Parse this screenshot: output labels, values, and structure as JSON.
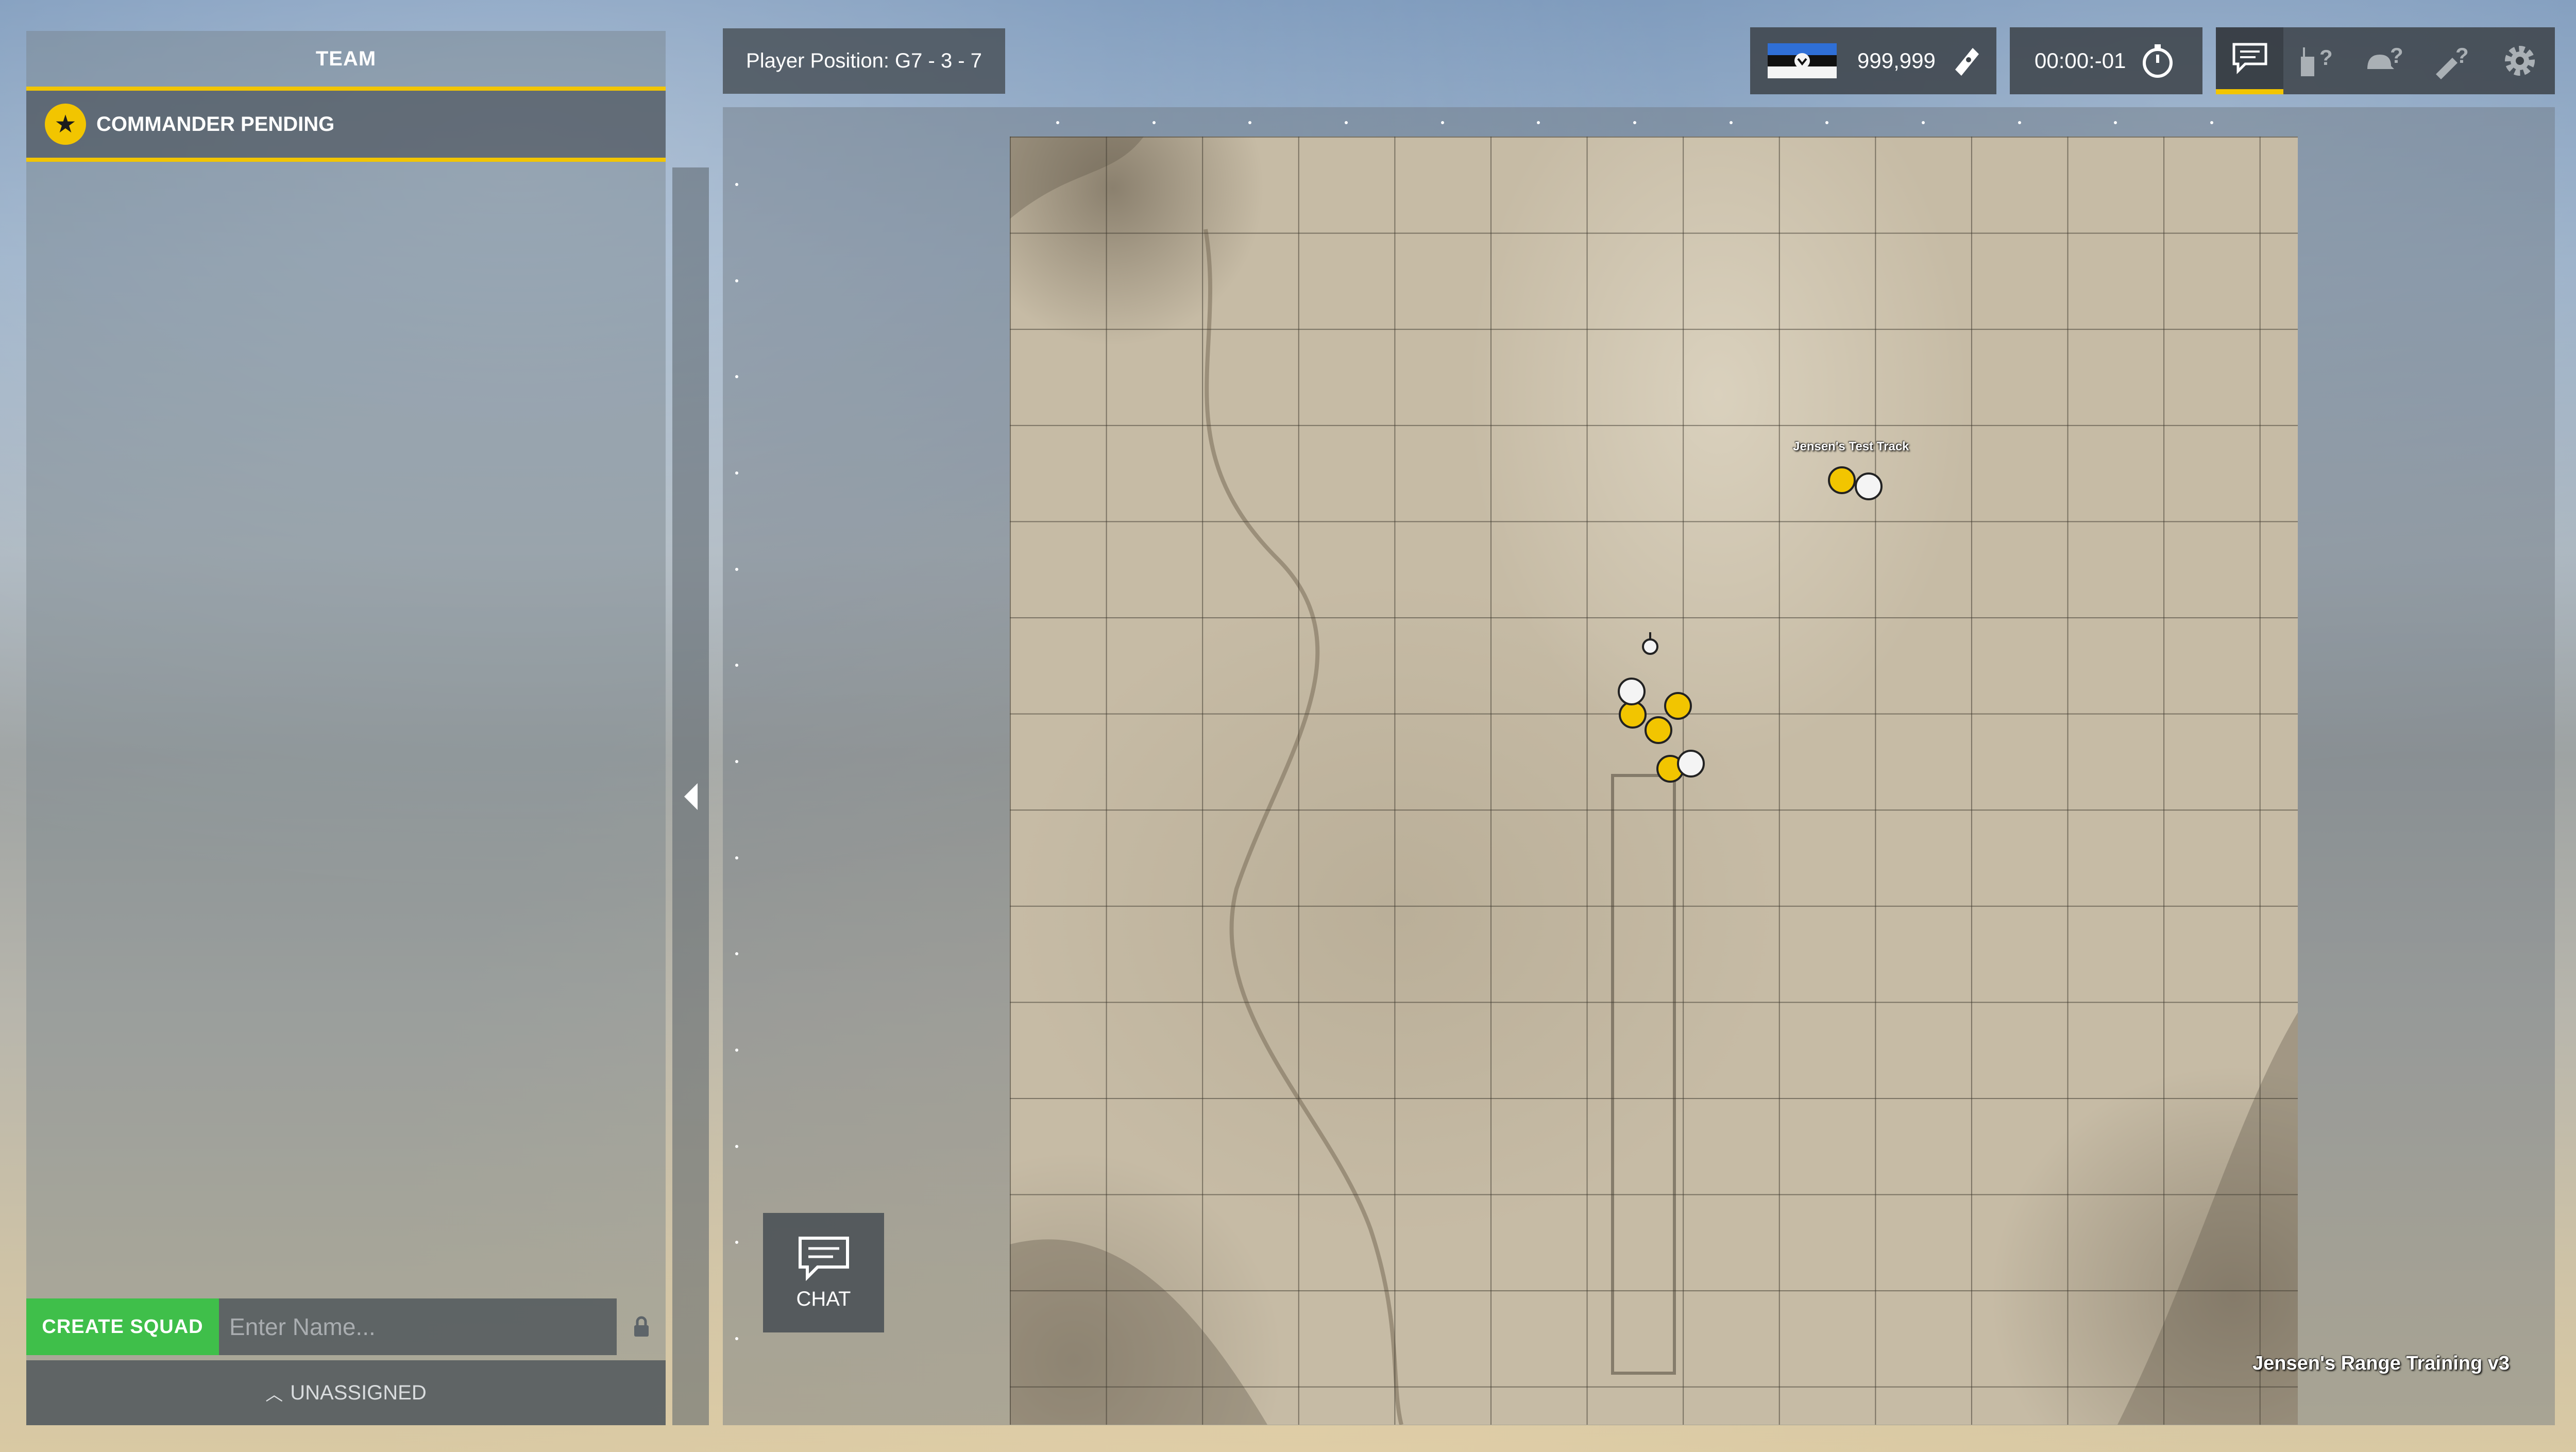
{
  "team_panel": {
    "title": "TEAM",
    "commander": "COMMANDER PENDING",
    "create_squad": "CREATE SQUAD",
    "squad_name_placeholder": "Enter Name...",
    "unassigned": "UNASSIGNED"
  },
  "top_bar": {
    "player_position": "Player Position: G7 - 3 - 7",
    "tickets": "999,999",
    "timer": "00:00:-01"
  },
  "toolbar": {
    "icons": [
      "chat-icon",
      "radio-help-icon",
      "helmet-help-icon",
      "rocket-help-icon",
      "settings-icon"
    ]
  },
  "map": {
    "name": "Jensen's Range Training v3",
    "poi_label": "Jensen's Test Track"
  },
  "chat_button": {
    "label": "CHAT"
  },
  "colors": {
    "accent": "#f2c500",
    "create_squad": "#3fbf4a"
  }
}
